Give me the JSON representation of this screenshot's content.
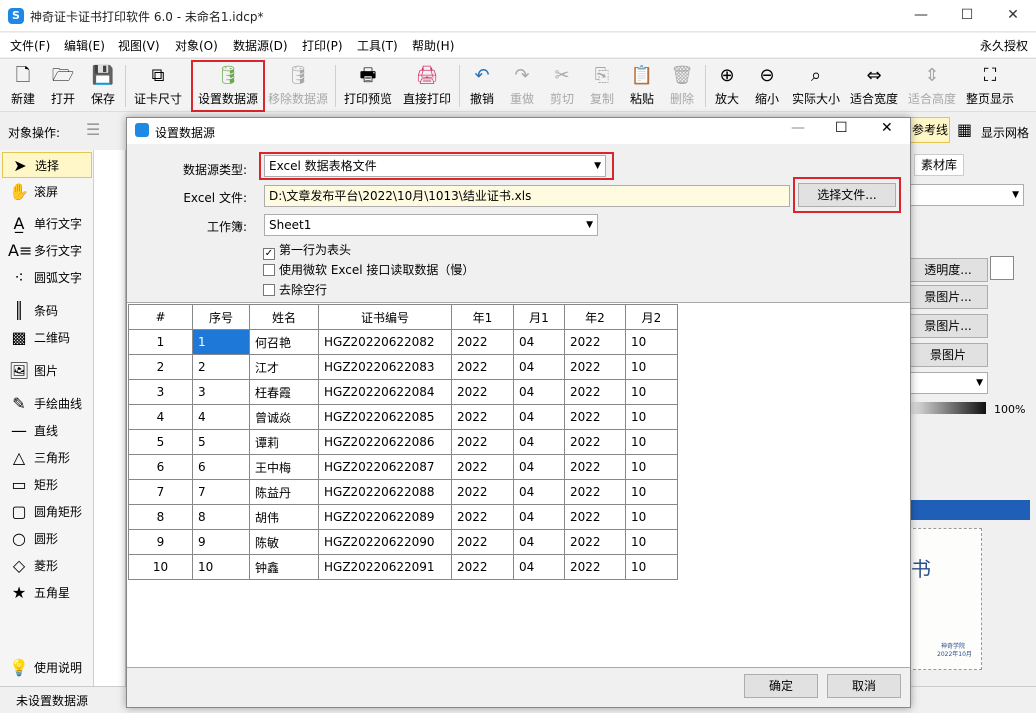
{
  "window": {
    "title": "神奇证卡证书打印软件 6.0 - 未命名1.idcp*",
    "app_logo": "S"
  },
  "menubar": {
    "items": [
      "文件(F)",
      "编辑(E)",
      "视图(V)",
      "对象(O)",
      "数据源(D)",
      "打印(P)",
      "工具(T)",
      "帮助(H)"
    ],
    "right": "永久授权"
  },
  "toolbar": {
    "new": "新建",
    "open": "打开",
    "save": "保存",
    "card_size": "证卡尺寸",
    "set_datasource": "设置数据源",
    "remove_datasource": "移除数据源",
    "print_preview": "打印预览",
    "direct_print": "直接打印",
    "undo": "撤销",
    "redo": "重做",
    "cut": "剪切",
    "copy": "复制",
    "paste": "粘贴",
    "delete": "删除",
    "zoom_in": "放大",
    "zoom_out": "缩小",
    "actual_size": "实际大小",
    "fit_width": "适合宽度",
    "fit_height": "适合高度",
    "full_page": "整页显示"
  },
  "objbar": {
    "label": "对象操作:",
    "ref_line": "参考线",
    "show_grid": "显示网格"
  },
  "tools": [
    "选择",
    "滚屏",
    "单行文字",
    "多行文字",
    "圆弧文字",
    "条码",
    "二维码",
    "图片",
    "手绘曲线",
    "直线",
    "三角形",
    "矩形",
    "圆角矩形",
    "圆形",
    "菱形",
    "五角星",
    "使用说明"
  ],
  "right_panel": {
    "tab": "素材库",
    "btn_transparency": "透明度...",
    "btn_bg1": "景图片...",
    "btn_bg2": "景图片...",
    "btn_bg3": "景图片",
    "opacity": "100%",
    "cert_char": "书",
    "cert_sign": "神奇学院",
    "cert_date": "2022年10月"
  },
  "status": {
    "left": "未设置数据源"
  },
  "dialog": {
    "title": "设置数据源",
    "type_label": "数据源类型:",
    "type_value": "Excel 数据表格文件",
    "file_label": "Excel 文件:",
    "file_value": "D:\\文章发布平台\\2022\\10月\\1013\\结业证书.xls",
    "choose_file": "选择文件...",
    "sheet_label": "工作簿:",
    "sheet_value": "Sheet1",
    "chk_header": "第一行为表头",
    "chk_header_checked": true,
    "chk_ms_excel": "使用微软 Excel 接口读取数据（慢）",
    "chk_remove_empty": "去除空行",
    "ok": "确定",
    "cancel": "取消",
    "columns": [
      "#",
      "序号",
      "姓名",
      "证书编号",
      "年1",
      "月1",
      "年2",
      "月2"
    ],
    "rows": [
      [
        "1",
        "1",
        "何召艳",
        "HGZ20220622082",
        "2022",
        "04",
        "2022",
        "10"
      ],
      [
        "2",
        "2",
        "江才",
        "HGZ20220622083",
        "2022",
        "04",
        "2022",
        "10"
      ],
      [
        "3",
        "3",
        "枉春霞",
        "HGZ20220622084",
        "2022",
        "04",
        "2022",
        "10"
      ],
      [
        "4",
        "4",
        "曾诚焱",
        "HGZ20220622085",
        "2022",
        "04",
        "2022",
        "10"
      ],
      [
        "5",
        "5",
        "谭莉",
        "HGZ20220622086",
        "2022",
        "04",
        "2022",
        "10"
      ],
      [
        "6",
        "6",
        "王中梅",
        "HGZ20220622087",
        "2022",
        "04",
        "2022",
        "10"
      ],
      [
        "7",
        "7",
        "陈益丹",
        "HGZ20220622088",
        "2022",
        "04",
        "2022",
        "10"
      ],
      [
        "8",
        "8",
        "胡伟",
        "HGZ20220622089",
        "2022",
        "04",
        "2022",
        "10"
      ],
      [
        "9",
        "9",
        "陈敏",
        "HGZ20220622090",
        "2022",
        "04",
        "2022",
        "10"
      ],
      [
        "10",
        "10",
        "钟鑫",
        "HGZ20220622091",
        "2022",
        "04",
        "2022",
        "10"
      ]
    ]
  }
}
